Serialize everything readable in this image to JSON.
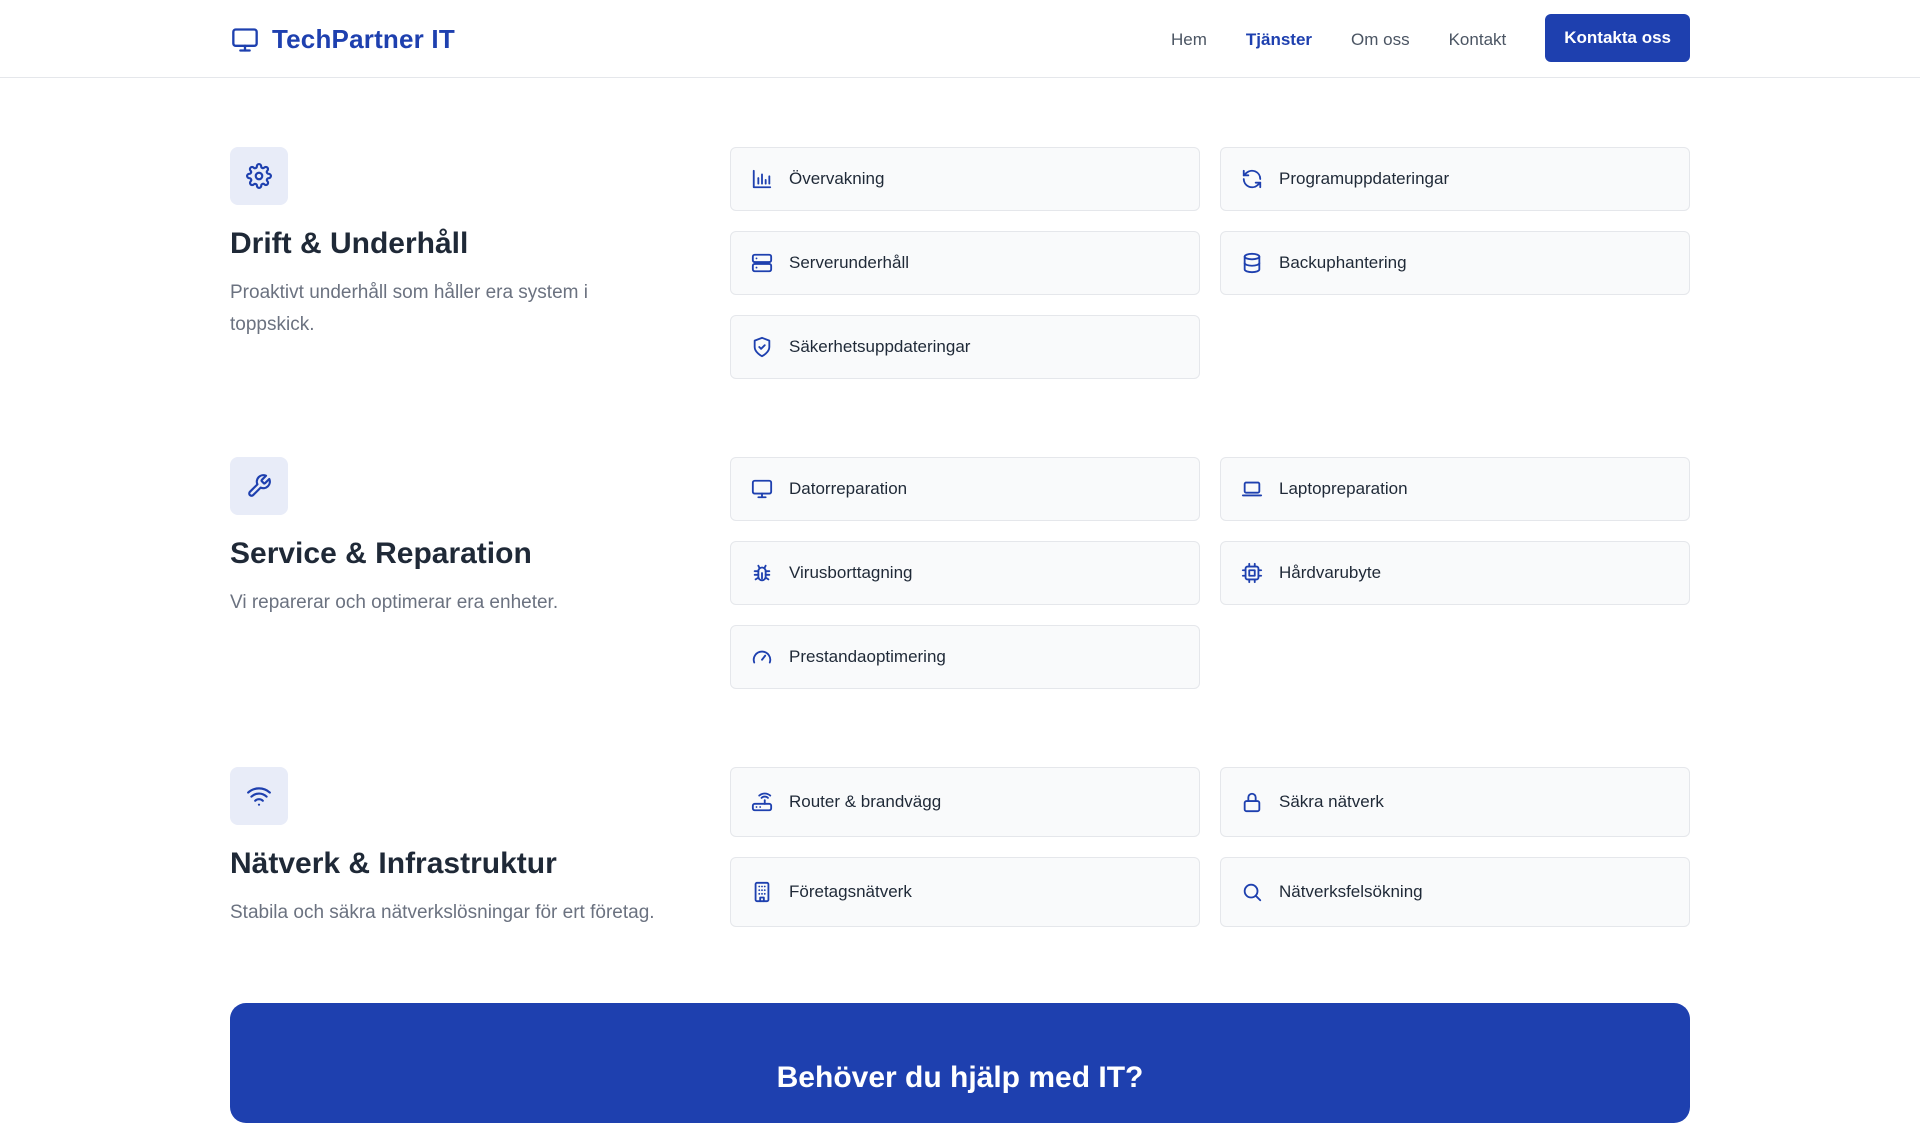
{
  "brand": {
    "name": "TechPartner IT",
    "icon": "monitor-icon"
  },
  "nav": {
    "links": [
      {
        "label": "Hem"
      },
      {
        "label": "Tjänster"
      },
      {
        "label": "Om oss"
      },
      {
        "label": "Kontakt"
      }
    ],
    "active": "Tjänster",
    "cta_label": "Kontakta oss"
  },
  "colors": {
    "accent": "#1e40af",
    "icon_bg": "#e8ecf8",
    "card_bg": "#f9fafb",
    "border": "#e5e7eb",
    "muted_text": "#6b7280"
  },
  "sections": [
    {
      "icon": "gear-icon",
      "title": "Drift & Underhåll",
      "description": "Proaktivt underhåll som håller era system i toppskick.",
      "items": [
        {
          "label": "Övervakning",
          "icon": "bar-chart-icon"
        },
        {
          "label": "Programuppdateringar",
          "icon": "refresh-icon"
        },
        {
          "label": "Serverunderhåll",
          "icon": "server-icon"
        },
        {
          "label": "Backuphantering",
          "icon": "database-icon"
        },
        {
          "label": "Säkerhetsuppdateringar",
          "icon": "shield-check-icon"
        }
      ]
    },
    {
      "icon": "wrench-icon",
      "title": "Service & Reparation",
      "description": "Vi reparerar och optimerar era enheter.",
      "items": [
        {
          "label": "Datorreparation",
          "icon": "monitor-icon"
        },
        {
          "label": "Laptopreparation",
          "icon": "laptop-icon"
        },
        {
          "label": "Virusborttagning",
          "icon": "bug-icon"
        },
        {
          "label": "Hårdvarubyte",
          "icon": "cpu-icon"
        },
        {
          "label": "Prestandaoptimering",
          "icon": "gauge-icon"
        }
      ]
    },
    {
      "icon": "wifi-icon",
      "title": "Nätverk & Infrastruktur",
      "description": "Stabila och säkra nätverkslösningar för ert företag.",
      "items": [
        {
          "label": "Router & brandvägg",
          "icon": "router-icon"
        },
        {
          "label": "Säkra nätverk",
          "icon": "lock-icon"
        },
        {
          "label": "Företagsnätverk",
          "icon": "building-icon"
        },
        {
          "label": "Nätverksfelsökning",
          "icon": "search-icon"
        }
      ]
    }
  ],
  "cta_banner": {
    "title": "Behöver du hjälp med IT?"
  }
}
